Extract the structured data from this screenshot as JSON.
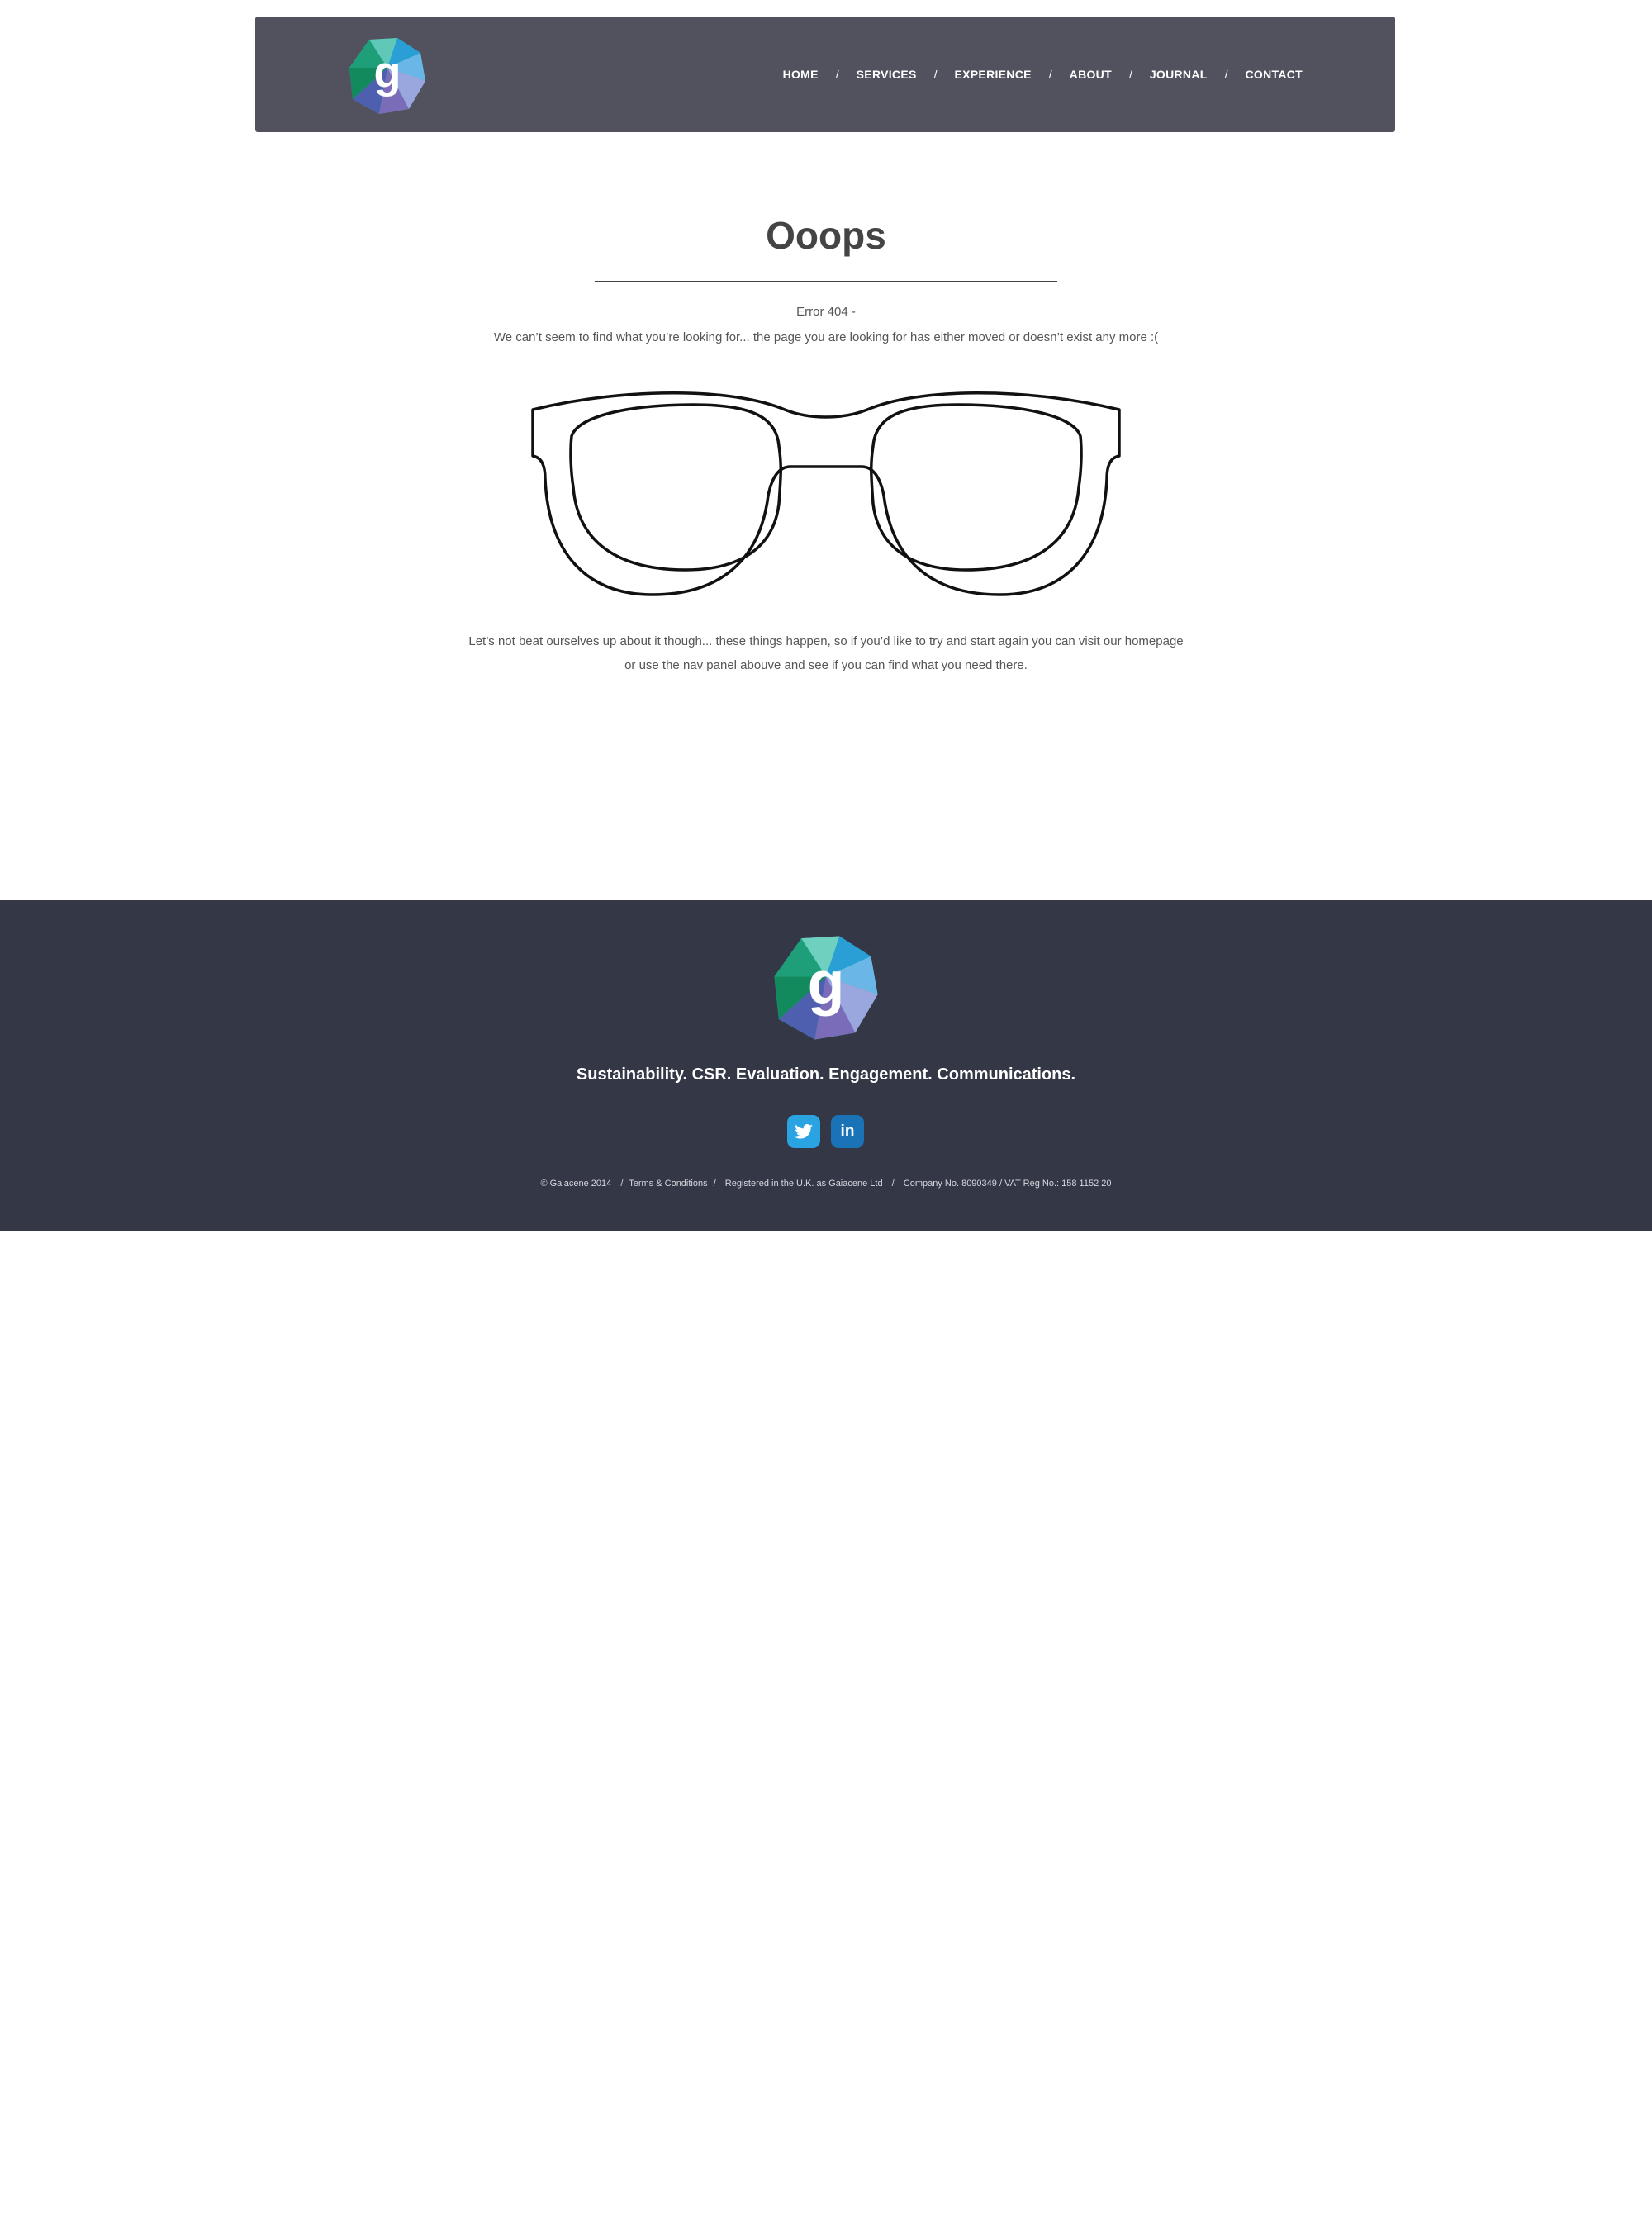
{
  "nav": {
    "items": [
      "HOME",
      "SERVICES",
      "EXPERIENCE",
      "ABOUT",
      "JOURNAL",
      "CONTACT"
    ],
    "separator": "/"
  },
  "logo": {
    "letter": "g"
  },
  "main": {
    "title": "Ooops",
    "error_code": "Error 404 -",
    "error_message": "We can’t seem to find what you’re looking for... the page you are looking for has either moved or doesn’t exist any more :(",
    "body_line1": "Let’s not beat ourselves up about it though... these things happen, so if you’d like to try and start again you can visit our homepage",
    "body_line2": "or use the nav panel abouve and see if you can find what you need there."
  },
  "footer": {
    "tagline": "Sustainability. CSR. Evaluation. Engagement. Communications.",
    "social": {
      "twitter_icon": "twitter-icon",
      "linkedin_label": "in"
    },
    "legal": {
      "copyright": "© Gaiacene 2014",
      "sep1": "/",
      "terms": "Terms & Conditions",
      "sep2": "/",
      "registered": "Registered in the U.K. as Gaiacene Ltd",
      "sep3": "/",
      "company": "Company No. 8090349 / VAT Reg No.: 158 1152 20"
    }
  },
  "colors": {
    "header_bg": "#52525f",
    "footer_bg": "#343746",
    "twitter": "#2aa3e3",
    "linkedin": "#1a73b6"
  }
}
